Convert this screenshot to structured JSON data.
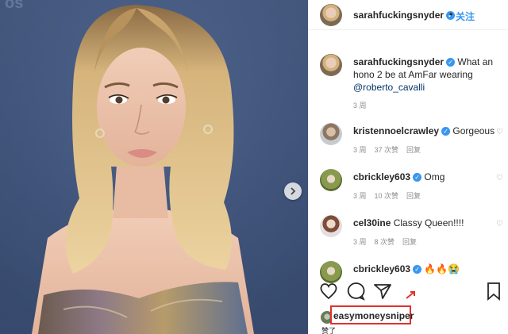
{
  "post": {
    "author": "sarahfuckingsnyder",
    "dot": "•",
    "follow_label": "关注"
  },
  "caption": {
    "author": "sarahfuckingsnyder",
    "text": " What an hono 2 be at AmFar wearing ",
    "mention": "@roberto_cavalli",
    "time": "3 周"
  },
  "comments": [
    {
      "user": "kristennoelcrawley",
      "verified": true,
      "text": " Gorgeous",
      "time": "3 周",
      "likes": "37 次赞",
      "reply": "回复"
    },
    {
      "user": "cbrickley603",
      "verified": true,
      "text": " Omg",
      "time": "3 周",
      "likes": "10 次赞",
      "reply": "回复"
    },
    {
      "user": "cel30ine",
      "verified": false,
      "text": " Classy Queen!!!!",
      "time": "3 周",
      "likes": "8 次赞",
      "reply": "回复"
    },
    {
      "user": "cbrickley603",
      "verified": true,
      "text": " 🔥🔥😭"
    }
  ],
  "liked_by": {
    "user": "easymoneysniper",
    "suffix": "赞了"
  },
  "colors": {
    "accent": "#3897f0",
    "highlight_box": "#e0322b",
    "backdrop": "#40557c"
  },
  "icons": [
    "chevron-right-icon",
    "verified-icon",
    "heart-icon",
    "comment-icon",
    "share-icon",
    "bookmark-icon"
  ]
}
